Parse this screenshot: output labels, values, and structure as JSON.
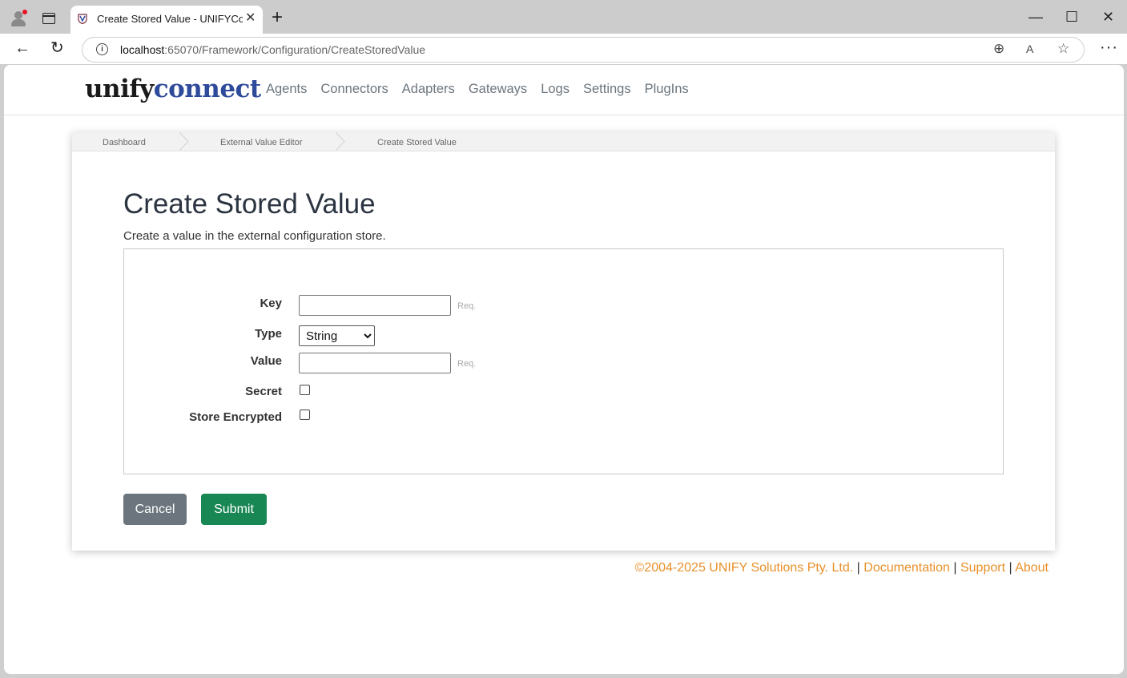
{
  "browser": {
    "tab_title": "Create Stored Value - UNIFYConnect",
    "url_host": "localhost",
    "url_rest": ":65070/Framework/Configuration/CreateStoredValue"
  },
  "logo": {
    "part1": "unify",
    "part2": "connect"
  },
  "nav": [
    "Agents",
    "Connectors",
    "Adapters",
    "Gateways",
    "Logs",
    "Settings",
    "PlugIns"
  ],
  "breadcrumb": [
    "Dashboard",
    "External Value Editor",
    "Create Stored Value"
  ],
  "page": {
    "title": "Create Stored Value",
    "subtitle": "Create a value in the external configuration store."
  },
  "form": {
    "key_label": "Key",
    "type_label": "Type",
    "type_selected": "String",
    "value_label": "Value",
    "secret_label": "Secret",
    "encrypted_label": "Store Encrypted",
    "required_hint": "Req.",
    "key_value": "",
    "value_value": "",
    "secret_checked": false,
    "encrypted_checked": false
  },
  "buttons": {
    "cancel": "Cancel",
    "submit": "Submit"
  },
  "footer": {
    "copyright": "©2004-2025 UNIFY Solutions Pty. Ltd.",
    "separator": "|",
    "documentation": "Documentation",
    "support": "Support",
    "about": "About"
  },
  "colors": {
    "brand_dark": "#1a1a1a",
    "brand_blue": "#2e4a9a",
    "cancel_button": "#6c757d",
    "submit_button": "#198754",
    "footer_link": "#e8902a"
  }
}
